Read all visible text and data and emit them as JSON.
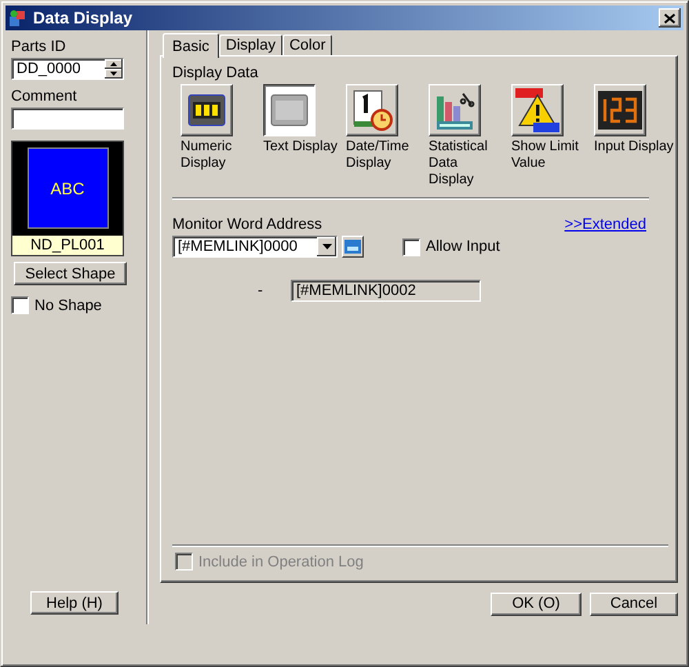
{
  "window": {
    "title": "Data Display"
  },
  "parts_id": {
    "label": "Parts ID",
    "value": "DD_0000"
  },
  "comment": {
    "label": "Comment"
  },
  "shape_preview": {
    "text": "ABC",
    "name": "ND_PL001"
  },
  "select_shape_button": "Select Shape",
  "no_shape": {
    "label": "No Shape",
    "checked": false
  },
  "tabs": [
    {
      "label": "Basic",
      "selected": true
    },
    {
      "label": "Display",
      "selected": false
    },
    {
      "label": "Color",
      "selected": false
    }
  ],
  "display_data": {
    "label": "Display Data",
    "types": [
      {
        "label": "Numeric Display",
        "kind": "numeric",
        "selected": false
      },
      {
        "label": "Text Display",
        "kind": "text",
        "selected": true
      },
      {
        "label": "Date/Time Display",
        "kind": "datetime",
        "selected": false
      },
      {
        "label": "Statistical Data Display",
        "kind": "statistical",
        "selected": false
      },
      {
        "label": "Show Limit Value",
        "kind": "limit",
        "selected": false
      },
      {
        "label": "Input Display",
        "kind": "input",
        "selected": false
      }
    ]
  },
  "monitor_word_address": {
    "label": "Monitor Word Address",
    "value": "[#MEMLINK]0000"
  },
  "allow_input": {
    "label": "Allow Input",
    "checked": false
  },
  "extended_link": ">>Extended",
  "dash": "-",
  "address_field": {
    "value": "[#MEMLINK]0002",
    "disabled": true
  },
  "include_in_operation_log": {
    "label": "Include in Operation Log",
    "checked": false,
    "disabled": true
  },
  "buttons": {
    "help": "Help (H)",
    "ok": "OK (O)",
    "cancel": "Cancel"
  }
}
